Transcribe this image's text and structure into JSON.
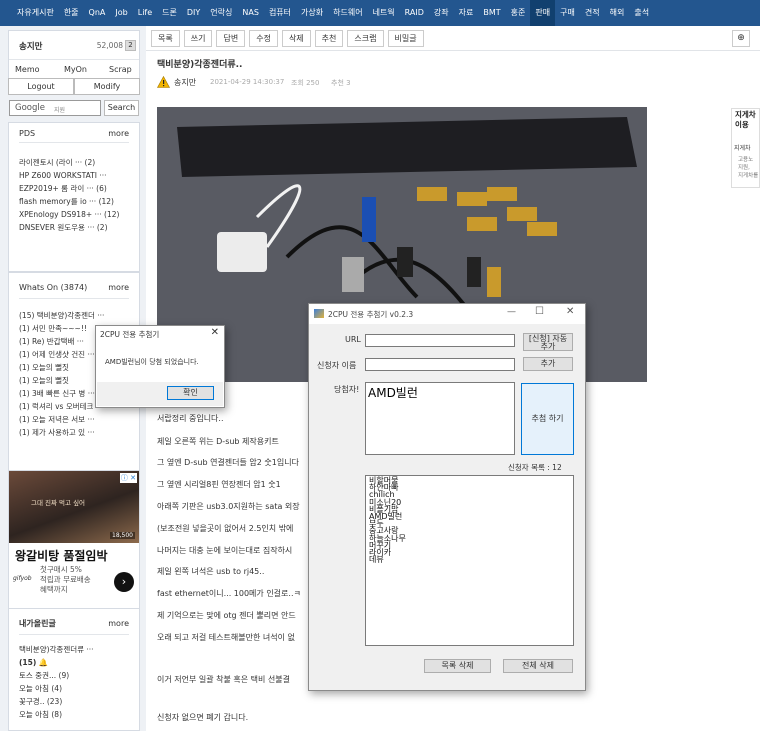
{
  "nav": {
    "items": [
      "자유게시판",
      "한줄",
      "QnA",
      "Job",
      "Life",
      "드론",
      "DIY",
      "언락싱",
      "NAS",
      "컴퓨터",
      "가상화",
      "하드웨어",
      "네트웍",
      "RAID",
      "강좌",
      "자료",
      "BMT",
      "홍준",
      "판매",
      "구매",
      "견적",
      "해외",
      "출석"
    ],
    "active_index": 18
  },
  "user": {
    "name": "송지만",
    "points": "52,008",
    "level": "2",
    "memo": "Memo",
    "myon": "MyOn",
    "scrap": "Scrap",
    "logout": "Logout",
    "modify": "Modify",
    "search_button": "Search",
    "google_label": "Google",
    "google_sub": "지원"
  },
  "pds": {
    "title": "PDS",
    "more": "more",
    "items": [
      "라이젠토시 (라이 ··· (2)",
      "HP Z600 WORKSTATI ···",
      "EZP2019+ 롬 라이 ··· (6)",
      "flash memory를 io ··· (12)",
      "XPEnology DS918+ ··· (12)",
      "DNSEVER 원도우용 ··· (2)"
    ]
  },
  "whatson": {
    "title": "Whats On (3874)",
    "more": "more",
    "items": [
      "(15) 택비분양)각종젠더 ···",
      "(1) 서민 만족~~~!!",
      "(1) Re) 반갑택배 ···",
      "(1) 어제 인생샷 건진 ···",
      "(1) 오늘의 뻘짓",
      "(1) 오늘의 뻘짓",
      "(1) 3배 빠른 신구 병 ···",
      "(1) 럭셔리 vs 오버테크",
      "(1) 오늘 저녁은 서보 ···",
      "(1) 제가 사용하고 있 ···"
    ]
  },
  "ad": {
    "title": "왕갈비탕 품절임박",
    "line1": "첫구매시 5%",
    "line2": "적립과 무료배송",
    "line3": "혜택까지",
    "brand": "gifyob",
    "photo_caption": "그대 진짜 먹고 싶어",
    "price": "18,500",
    "adx": "ⓘ ✕"
  },
  "mywrite": {
    "title": "내가올린글",
    "more": "more",
    "items": [
      "택비분양)각종젠더류 ···",
      "(15)",
      "토스 중권... (9)",
      "오늘 아침 (4)",
      "꽃구경.. (23)",
      "오늘 아침 (8)"
    ]
  },
  "toolbar": {
    "buttons": [
      "목록",
      "쓰기",
      "답변",
      "수정",
      "삭제",
      "추천",
      "스크랩",
      "비밀글"
    ]
  },
  "post": {
    "title": "택비분양)각종젠더류..",
    "author": "송지만",
    "date": "2021-04-29 14:30:37",
    "views_label": "조회 250",
    "recommend_label": "추천 3"
  },
  "right_ad": {
    "line1": "지게차",
    "line2": "이용",
    "line3": "지게차",
    "line4": "고용노",
    "line5": "지원,",
    "line6": "지게차를"
  },
  "body_lines": [
    "서랍정리 중입니다..",
    "제일 오른쪽 위는 D-sub 제작용키트",
    "그 옆엔 D-sub 연결젠더들 암2 숫1입니다",
    "그 옆엔 시리얼8핀 연장젠더 암1 숫1",
    "아래쪽 기판은 usb3.0지원하는 sata 외장",
    "(보조전원 넣을곳이 없어서 2.5인치 밖에",
    "나머지는 대충 눈에 보이는대로 짐작하시",
    "제일 왼쪽 녀석은 usb to rj45..",
    "fast ethernet이니... 100메가 인걸로..ㅋ",
    "제 기억으로는 맞에 otg 젠더 뿔리면 안드",
    "오래 되고 저걸 테스트해볼만한 녀석이 없",
    "이거 저언부 일괄 착불 혹은 택비 선불결",
    "신청자 없으면 폐기 갑니다."
  ],
  "small_dialog": {
    "title": "2CPU 전용 추첨기",
    "message": "AMD빌런님이 당첨 되었습니다.",
    "ok": "확인",
    "close": "✕"
  },
  "app": {
    "title": "2CPU 전용 추첨기 v0.2.3",
    "url_label": "URL",
    "applicant_label": "신청자 이름",
    "winner_label": "당첨자!",
    "winner": "AMD빌런",
    "apply_button": "[신청] 자동 추가",
    "add_button": "추가",
    "draw_button": "추첨 하기",
    "list_label": "신청자 목록 : 12",
    "list": [
      "비할머물",
      "하얀마빠",
      "chilich",
      "미소닌20",
      "비폴기밥",
      "AMD빌런",
      "부두",
      "중고사랑",
      "하늘소나무",
      "머꾸기",
      "라이카",
      "데뷰"
    ],
    "delete_list_button": "목록 삭제",
    "delete_all_button": "전체 삭제",
    "min": "—",
    "max": "☐",
    "close": "✕"
  },
  "icons": {
    "search": "search-icon",
    "user_level": "warning-icon"
  }
}
